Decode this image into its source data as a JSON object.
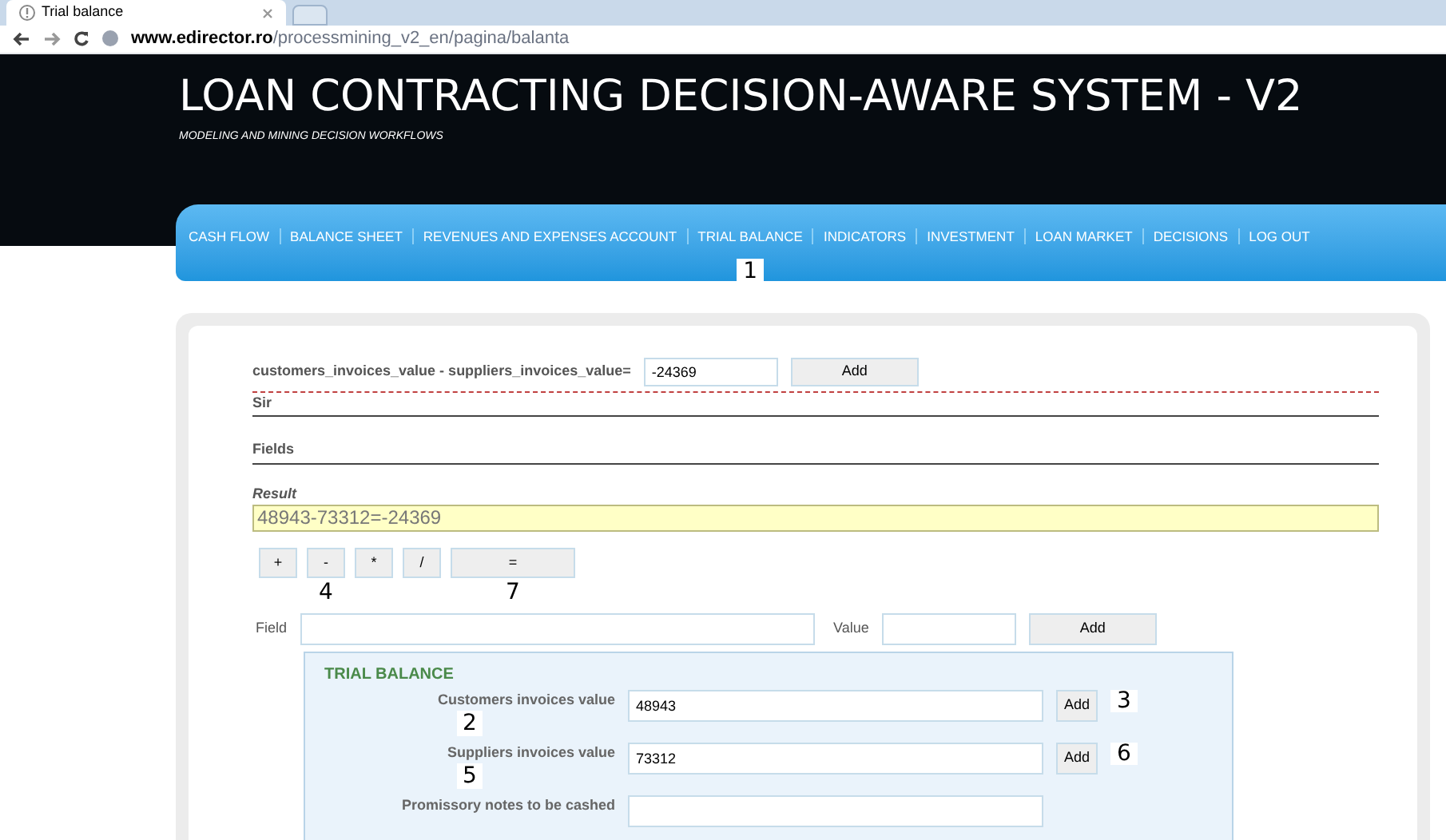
{
  "browser": {
    "tab_title": "Trial balance",
    "url_host": "www.edirector.ro",
    "url_path": "/processmining_v2_en/pagina/balanta"
  },
  "header": {
    "title": "LOAN CONTRACTING DECISION-AWARE SYSTEM - V2",
    "subtitle": "MODELING AND MINING DECISION WORKFLOWS"
  },
  "nav": {
    "items": [
      {
        "label": "CASH FLOW",
        "marker": ""
      },
      {
        "label": "BALANCE SHEET"
      },
      {
        "label": "REVENUES AND EXPENSES ACCOUNT"
      },
      {
        "label": "TRIAL BALANCE",
        "marker": "1"
      },
      {
        "label": "INDICATORS"
      },
      {
        "label": "INVESTMENT"
      },
      {
        "label": "LOAN MARKET"
      },
      {
        "label": "DECISIONS"
      },
      {
        "label": "LOG OUT"
      }
    ]
  },
  "formula": {
    "label": "customers_invoices_value - suppliers_invoices_value=",
    "value": "-24369",
    "button": "Add"
  },
  "sections": [
    "Sir",
    "Fields"
  ],
  "result": {
    "label": "Result",
    "value": "48943-73312=-24369"
  },
  "operators": [
    {
      "label": "+"
    },
    {
      "label": "-",
      "marker": "4"
    },
    {
      "label": "*"
    },
    {
      "label": "/"
    },
    {
      "label": "=",
      "marker": "7"
    }
  ],
  "field_row": {
    "field_label": "Field",
    "value_label": "Value",
    "button": "Add"
  },
  "trial_balance": {
    "title": "TRIAL BALANCE",
    "rows": [
      {
        "label": "Customers invoices value",
        "value": "48943",
        "button": "Add",
        "label_marker": "2",
        "button_marker": "3"
      },
      {
        "label": "Suppliers invoices value",
        "value": "73312",
        "button": "Add",
        "label_marker": "5",
        "button_marker": "6"
      },
      {
        "label": "Promissory notes to be cashed"
      }
    ]
  }
}
